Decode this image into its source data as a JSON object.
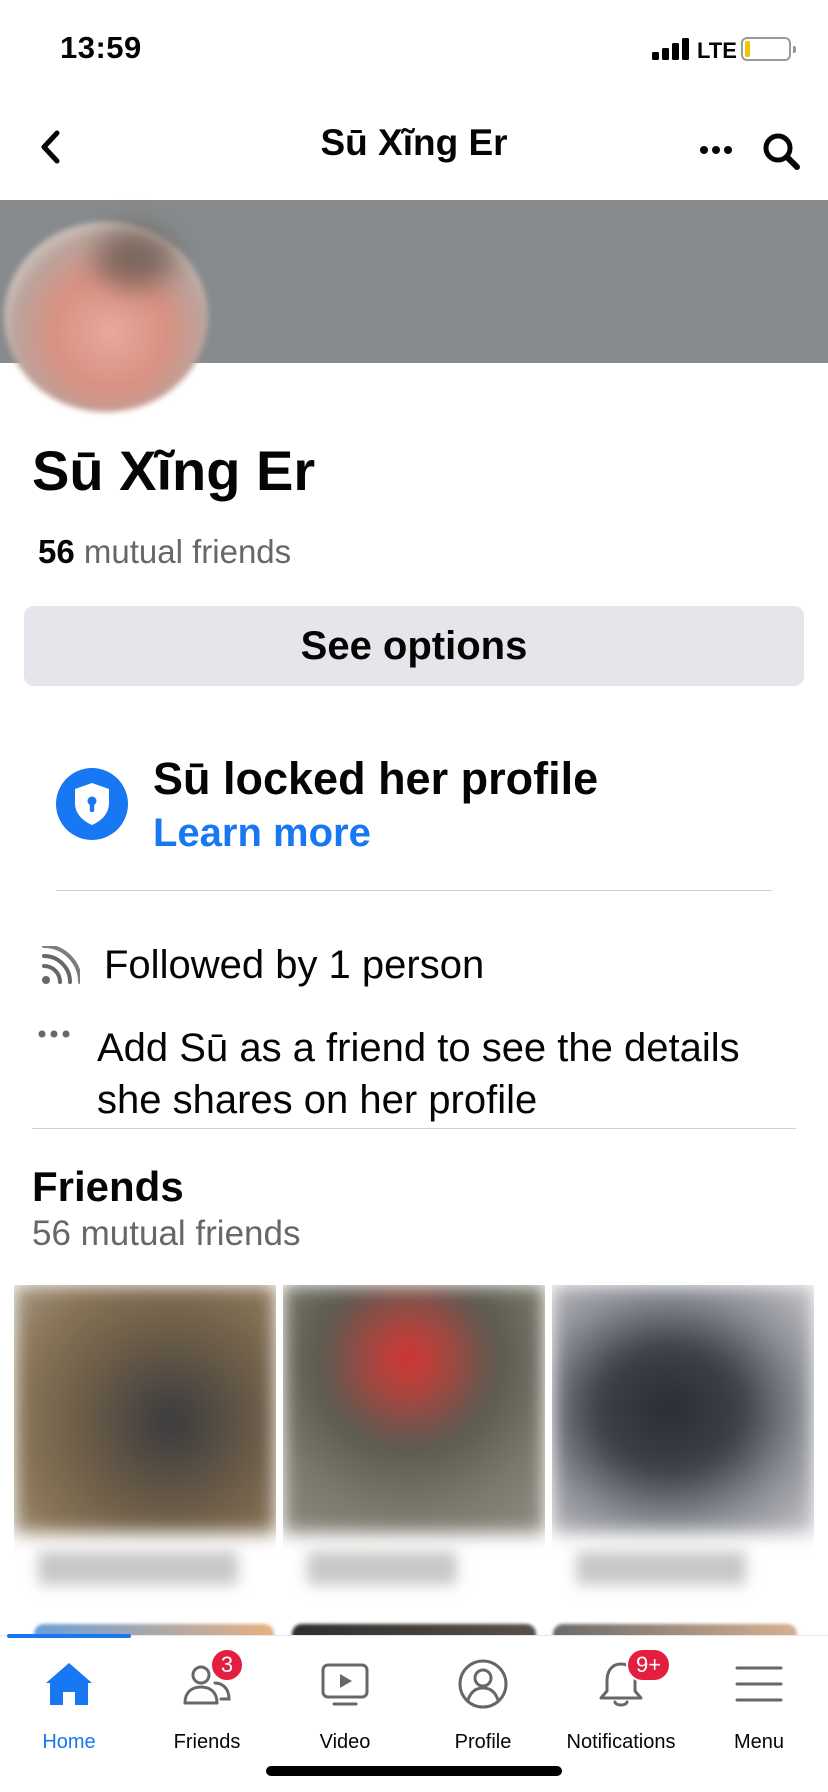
{
  "status_bar": {
    "time": "13:59",
    "network": "LTE"
  },
  "nav": {
    "title": "Sū Xĩng Er",
    "back_icon": "chevron-left-icon",
    "more_icon": "more-dots-icon",
    "search_icon": "search-icon"
  },
  "profile": {
    "name": "Sū Xĩng Er",
    "mutual_count": "56",
    "mutual_suffix": " mutual friends",
    "see_options_label": "See options"
  },
  "locked": {
    "title": "Sū locked her profile",
    "learn_more": "Learn more"
  },
  "details": {
    "followed": "Followed by 1 person",
    "add_friend": "Add Sū as a friend to see the details she shares on her profile"
  },
  "friends": {
    "title": "Friends",
    "subtitle": "56 mutual friends"
  },
  "tab_bar": {
    "tabs": [
      {
        "label": "Home",
        "icon": "home-icon",
        "active": true
      },
      {
        "label": "Friends",
        "icon": "friends-icon",
        "badge": "3"
      },
      {
        "label": "Video",
        "icon": "video-icon"
      },
      {
        "label": "Profile",
        "icon": "profile-icon"
      },
      {
        "label": "Notifications",
        "icon": "bell-icon",
        "badge": "9+"
      },
      {
        "label": "Menu",
        "icon": "menu-icon"
      }
    ]
  },
  "colors": {
    "accent": "#1877f2",
    "badge": "#e41e3f",
    "cover": "#878b8d",
    "button_bg": "#e4e6eb",
    "secondary_text": "#65676b"
  }
}
